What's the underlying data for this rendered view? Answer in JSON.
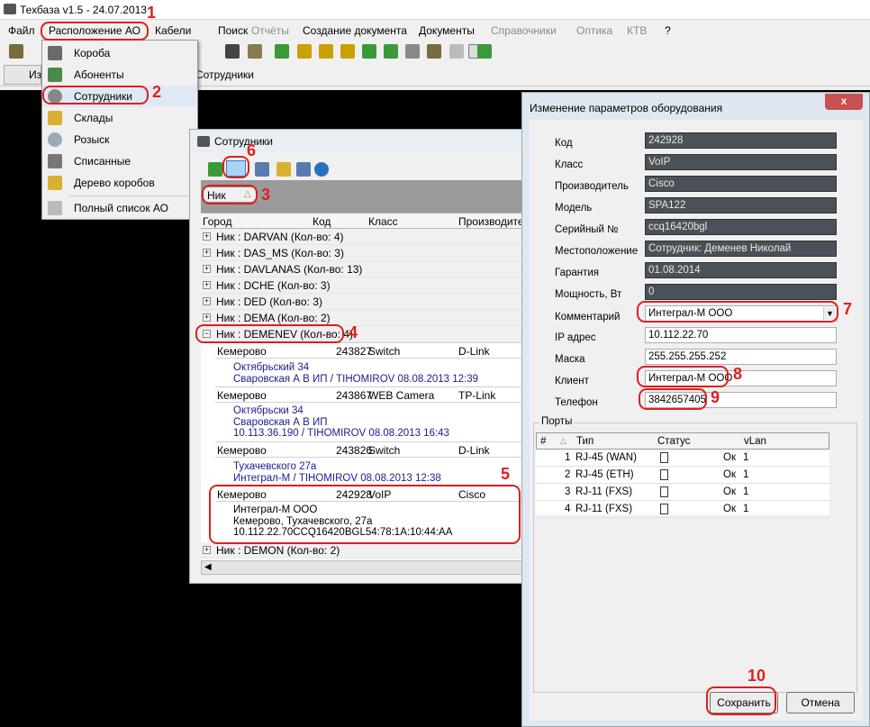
{
  "app": {
    "title": "Техбаза v1.5 - 24.07.2013",
    "menu": [
      "Файл",
      "Расположение АО",
      "Кабели",
      "Поиск",
      "Отчёты",
      "Создание документа",
      "Документы",
      "Справочники",
      "Оптика",
      "КТВ",
      "?"
    ],
    "tab_label": "Сотрудники",
    "tab_left_label": "Из"
  },
  "dropdown": {
    "items": [
      "Короба",
      "Абоненты",
      "Сотрудники",
      "Склады",
      "Розыск",
      "Списанные",
      "Дерево коробов",
      "Полный список АО"
    ]
  },
  "employees": {
    "title": "Сотрудники",
    "group_by": "Ник",
    "columns": [
      "Город",
      "Код",
      "Класс",
      "Производител"
    ],
    "groups_before": [
      "Ник : DARVAN (Кол-во: 4)",
      "Ник : DAS_MS (Кол-во: 3)",
      "Ник : DAVLANAS (Кол-во: 13)",
      "Ник : DCHE (Кол-во: 3)",
      "Ник : DED (Кол-во: 3)",
      "Ник : DEMA (Кол-во: 2)"
    ],
    "expanded_group": "Ник : DEMENEV (Кол-во: 4)",
    "records": [
      {
        "city": "Кемерово",
        "code": "243827",
        "cls": "Switch",
        "maker": "D-Link",
        "d1": "Октябрьский 34",
        "d2": "Сваровская А В ИП / TIHOMIROV 08.08.2013 12:39",
        "d3": ""
      },
      {
        "city": "Кемерово",
        "code": "243867",
        "cls": "WEB Camera",
        "maker": "TP-Link",
        "d1": "Октябрьски 34",
        "d2": "Сваровская А В ИП",
        "d3": "10.113.36.190 / TIHOMIROV 08.08.2013 16:43"
      },
      {
        "city": "Кемерово",
        "code": "243826",
        "cls": "Switch",
        "maker": "D-Link",
        "d1": "Тухачевского 27а",
        "d2": "Интеграл-М / TIHOMIROV 08.08.2013 12:38",
        "d3": ""
      },
      {
        "city": "Кемерово",
        "code": "242928",
        "cls": "VoIP",
        "maker": "Cisco",
        "d1": "Интеграл-М ООО",
        "d2": "Кемерово, Тухачевского, 27а",
        "d3": "10.112.22.70CCQ16420BGL54:78:1A:10:44:AA"
      }
    ],
    "group_after": "Ник : DEMON (Кол-во: 2)"
  },
  "dialog": {
    "title": "Изменение параметров оборудования",
    "close": "x",
    "fields": [
      {
        "label": "Код",
        "value": "242928"
      },
      {
        "label": "Класс",
        "value": "VoIP"
      },
      {
        "label": "Производитель",
        "value": "Cisco"
      },
      {
        "label": "Модель",
        "value": "SPA122"
      },
      {
        "label": "Серийный №",
        "value": "ccq16420bgl"
      },
      {
        "label": "Местоположение",
        "value": "Сотрудник: Деменев Николай"
      },
      {
        "label": "Гарантия",
        "value": "01.08.2014"
      },
      {
        "label": "Мощность, Вт",
        "value": "0"
      }
    ],
    "comment_label": "Комментарий",
    "comment_value": "Интеграл-М ООО",
    "ip_label": "IP адрес",
    "ip_value": "10.112.22.70",
    "mask_label": "Маска",
    "mask_value": "255.255.255.252",
    "client_label": "Клиент",
    "client_value": "Интеграл-М ООО",
    "phone_label": "Телефон",
    "phone_value": "3842657405",
    "ports_title": "Порты",
    "ports_columns": [
      "#",
      "Тип",
      "Статус",
      "vLan"
    ],
    "ports": [
      {
        "n": "1",
        "type": "RJ-45 (WAN)",
        "status": "Ок",
        "vlan": "1"
      },
      {
        "n": "2",
        "type": "RJ-45 (ETH)",
        "status": "Ок",
        "vlan": "1"
      },
      {
        "n": "3",
        "type": "RJ-11 (FXS)",
        "status": "Ок",
        "vlan": "1"
      },
      {
        "n": "4",
        "type": "RJ-11 (FXS)",
        "status": "Ок",
        "vlan": "1"
      }
    ],
    "save_label": "Сохранить",
    "cancel_label": "Отмена"
  },
  "annotations": [
    "1",
    "2",
    "3",
    "4",
    "5",
    "6",
    "7",
    "8",
    "9",
    "10"
  ],
  "colors": {
    "annotation_red": "#e01e1e",
    "readonly_field": "#4a5158",
    "detail_text": "#1c1c8c"
  }
}
